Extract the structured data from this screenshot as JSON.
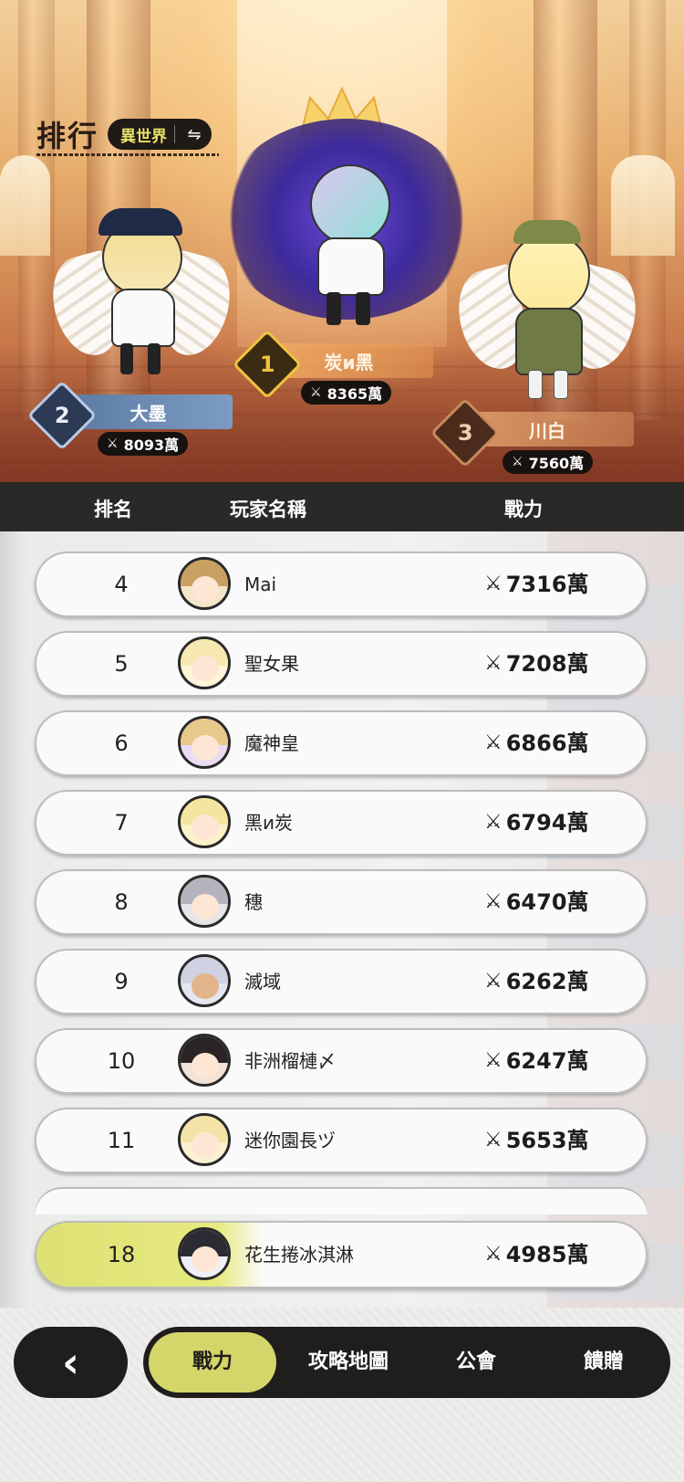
{
  "hero": {
    "title": "排行",
    "world_switch": {
      "label": "異世界",
      "icon": "swap-icon"
    },
    "podium": [
      {
        "rank": "1",
        "name": "炭и黑",
        "power": "8365萬"
      },
      {
        "rank": "2",
        "name": "大墨",
        "power": "8093萬"
      },
      {
        "rank": "3",
        "name": "川白",
        "power": "7560萬"
      }
    ]
  },
  "columns": {
    "rank": "排名",
    "name": "玩家名稱",
    "power": "戰力"
  },
  "rows": [
    {
      "rank": "4",
      "name": "Mai",
      "power": "7316萬"
    },
    {
      "rank": "5",
      "name": "聖女果",
      "power": "7208萬"
    },
    {
      "rank": "6",
      "name": "魔神皇",
      "power": "6866萬"
    },
    {
      "rank": "7",
      "name": "黑и炭",
      "power": "6794萬"
    },
    {
      "rank": "8",
      "name": "穗",
      "power": "6470萬"
    },
    {
      "rank": "9",
      "name": "滅域",
      "power": "6262萬"
    },
    {
      "rank": "10",
      "name": "非洲榴槤〆",
      "power": "6247萬"
    },
    {
      "rank": "11",
      "name": "迷你園長ヅ",
      "power": "5653萬"
    }
  ],
  "my_rank": {
    "rank": "18",
    "name": "花生捲冰淇淋",
    "power": "4985萬"
  },
  "nav": {
    "back_icon": "chevron-left-icon",
    "tabs": [
      "戰力",
      "攻略地圖",
      "公會",
      "饋贈"
    ]
  },
  "colors": {
    "accent": "#d4d66a",
    "dark": "#1f1e1d",
    "gold": "#f3c23d"
  }
}
